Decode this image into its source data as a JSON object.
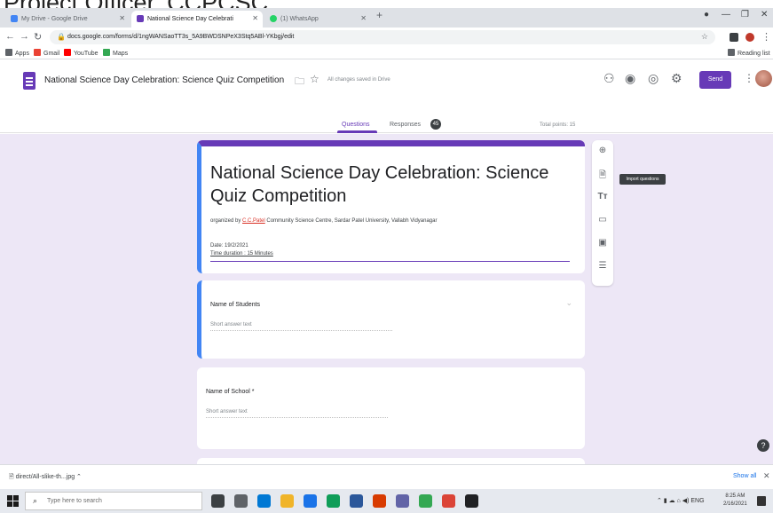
{
  "caption": "Project Officer, CCPCSC",
  "browser": {
    "tabs": [
      {
        "label": "My Drive - Google Drive",
        "color": "#4285f4"
      },
      {
        "label": "National Science Day Celebrati",
        "color": "#673ab7"
      },
      {
        "label": "(1) WhatsApp",
        "color": "#25d366"
      }
    ],
    "url": "docs.google.com/forms/d/1ngWANSaoTT3s_5A9BWDSNPeX3Stq5ABl-YKbgj/edit",
    "bookmarks": [
      {
        "label": "Apps",
        "color": "#5f6368"
      },
      {
        "label": "Gmail",
        "color": "#ea4335"
      },
      {
        "label": "YouTube",
        "color": "#ff0000"
      },
      {
        "label": "Maps",
        "color": "#34a853"
      }
    ],
    "reading_list": "Reading list"
  },
  "forms_header": {
    "doc_title": "National Science Day Celebration: Science Quiz Competition",
    "saved_status": "All changes saved in Drive",
    "send_label": "Send",
    "tab_questions": "Questions",
    "tab_responses": "Responses",
    "responses_count": "45",
    "total_points": "Total points: 15"
  },
  "form": {
    "title": "National Science Day Celebration: Science Quiz Competition",
    "description_prefix": "organized by ",
    "description_link": "C.C.Patel",
    "description_suffix": " Community Science Centre, Sardar Patel University, Vallabh Vidyanagar",
    "date": "Date: 19/2/2021",
    "duration": "Time duration : 15 Minutes",
    "tooltip": "Import questions",
    "questions": [
      {
        "label": "Name of Students",
        "placeholder": "Short answer text"
      },
      {
        "label": "Name of School *",
        "placeholder": "Short answer text"
      }
    ]
  },
  "downloads": {
    "item": "direct/All-slike-th...jpg",
    "show_all": "Show all"
  },
  "taskbar": {
    "search_placeholder": "Type here to search",
    "clock_time": "8:25 AM",
    "clock_date": "2/16/2021",
    "apps": [
      "#3c4043",
      "#5f6368",
      "#0078d4",
      "#f0b429",
      "#1a73e8",
      "#0f9d58",
      "#2b579a",
      "#d83b01",
      "#6264a7",
      "#34a853",
      "#db4437",
      "#202124"
    ]
  }
}
